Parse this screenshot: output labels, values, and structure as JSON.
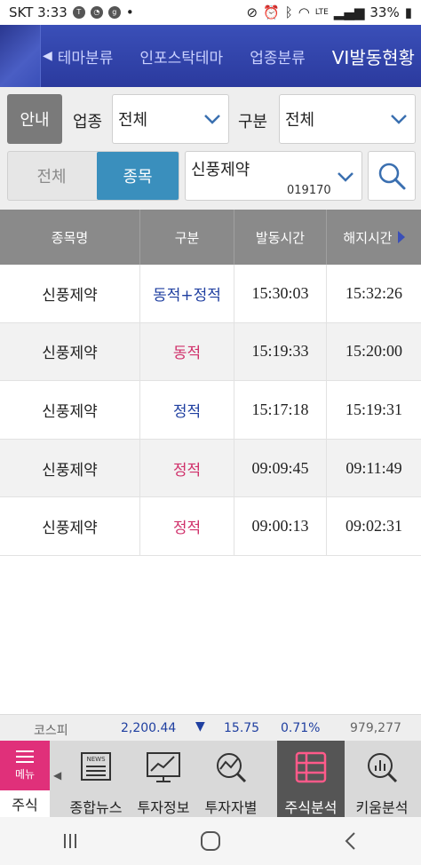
{
  "status_bar": {
    "carrier_time": "SKT 3:33",
    "battery": "33%",
    "network": "LTE"
  },
  "tabs": {
    "items": [
      "테마분류",
      "인포스탁테마",
      "업종분류",
      "VI발동현황"
    ],
    "active_index": 3
  },
  "filters": {
    "guide_label": "안내",
    "industry_label": "업종",
    "industry_value": "전체",
    "type_label": "구분",
    "type_value": "전체",
    "segment": [
      "전체",
      "종목"
    ],
    "segment_selected": "종목",
    "stock_name": "신풍제약",
    "stock_code": "019170"
  },
  "table": {
    "headers": [
      "종목명",
      "구분",
      "발동시간",
      "해지시간"
    ],
    "rows": [
      {
        "name": "신풍제약",
        "type": "동적+정적",
        "type_color": "#1f3fa0",
        "trigger": "15:30:03",
        "release": "15:32:26"
      },
      {
        "name": "신풍제약",
        "type": "동적",
        "type_color": "#d0306a",
        "trigger": "15:19:33",
        "release": "15:20:00"
      },
      {
        "name": "신풍제약",
        "type": "정적",
        "type_color": "#1f3fa0",
        "trigger": "15:17:18",
        "release": "15:19:31"
      },
      {
        "name": "신풍제약",
        "type": "정적",
        "type_color": "#d0306a",
        "trigger": "09:09:45",
        "release": "09:11:49"
      },
      {
        "name": "신풍제약",
        "type": "정적",
        "type_color": "#d0306a",
        "trigger": "09:00:13",
        "release": "09:02:31"
      }
    ]
  },
  "ticker": {
    "index_name": "코스피",
    "value": "2,200.44",
    "direction": "down",
    "change": "15.75",
    "change_pct": "0.71%",
    "volume": "979,277"
  },
  "bottom_nav": {
    "menu_label": "메뉴",
    "section_label": "주식",
    "items": [
      {
        "label": "종합뉴스",
        "icon": "news-icon"
      },
      {
        "label": "투자정보",
        "icon": "chart-monitor-icon"
      },
      {
        "label": "투자자별",
        "icon": "chart-search-icon"
      },
      {
        "label": "주식분석",
        "icon": "grid-table-icon"
      },
      {
        "label": "키움분석",
        "icon": "bar-search-icon"
      }
    ],
    "active_index": 3
  },
  "colors": {
    "tab_bg": "#2b3a9e",
    "accent_blue": "#3a8fbd",
    "menu_pink": "#e0307a",
    "down_blue": "#1f3fa0"
  }
}
